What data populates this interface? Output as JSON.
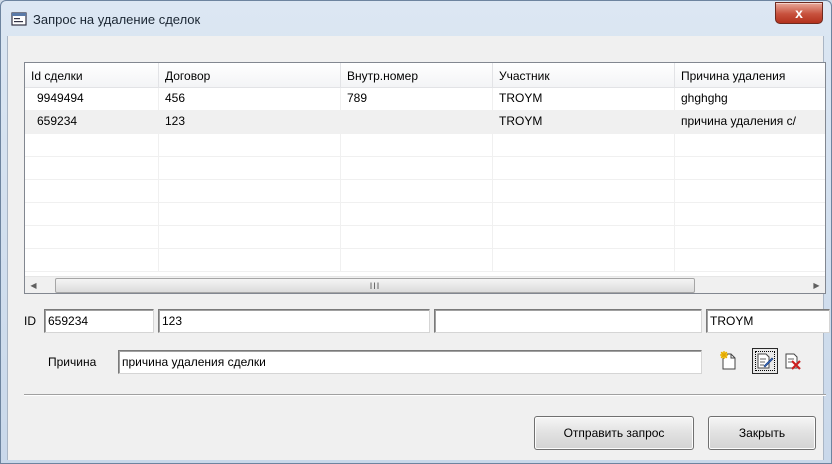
{
  "window": {
    "title": "Запрос на удаление сделок",
    "close_glyph": "x",
    "title_icon": "dialog-window-icon"
  },
  "listview": {
    "columns": [
      "Id сделки",
      "Договор",
      "Внутр.номер",
      "Участник",
      "Причина удаления"
    ],
    "rows": [
      [
        "9949494",
        "456",
        "789",
        "TROYM",
        "ghghghg"
      ],
      [
        "659234",
        "123",
        "",
        "TROYM",
        "причина удаления с/"
      ]
    ],
    "scroll_thumb_glyph": "III"
  },
  "edit": {
    "id_label": "ID",
    "id_value": "659234",
    "contract_value": "123",
    "internal_value": "",
    "participant_value": "TROYM",
    "reason_label": "Причина",
    "reason_value": "причина удаления сделки"
  },
  "toolbar": {
    "new_icon": "new-document-icon",
    "edit_icon": "edit-document-icon",
    "delete_icon": "delete-document-icon"
  },
  "buttons": {
    "send_label": "Отправить запрос",
    "close_label": "Закрыть"
  },
  "colors": {
    "close_button": "#c7513d",
    "title_bar": "#dce7f3",
    "delete_red": "#cc1f1f"
  }
}
